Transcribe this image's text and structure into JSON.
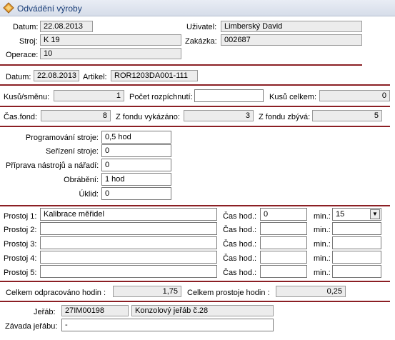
{
  "window": {
    "title": "Odvádění výroby",
    "icon": "diamond-arrows-icon"
  },
  "header": {
    "datum_label": "Datum:",
    "datum_value": "22.08.2013",
    "stroj_label": "Stroj:",
    "stroj_value": "K 19",
    "operace_label": "Operace:",
    "operace_value": "10",
    "uzivatel_label": "Uživatel:",
    "uzivatel_value": "Limberský David",
    "zakazka_label": "Zakázka:",
    "zakazka_value": "002687"
  },
  "second": {
    "datum_label": "Datum:",
    "datum_value": "22.08.2013",
    "artikel_label": "Artikel:",
    "artikel_value": "ROR1203DA001-111"
  },
  "counts": {
    "kusu_smenu_label": "Kusů/směnu:",
    "kusu_smenu_value": "1",
    "pocet_rozpichnuti_label": "Počet rozpíchnutí:",
    "pocet_rozpichnuti_value": "",
    "kusu_celkem_label": "Kusů celkem:",
    "kusu_celkem_value": "0"
  },
  "fond": {
    "cas_fond_label": "Čas.fond:",
    "cas_fond_value": "8",
    "z_fondu_vykazano_label": "Z fondu vykázáno:",
    "z_fondu_vykazano_value": "3",
    "z_fondu_zbyva_label": "Z fondu zbývá:",
    "z_fondu_zbyva_value": "5"
  },
  "activities": [
    {
      "label": "Programování stroje:",
      "value": "0,5 hod"
    },
    {
      "label": "Seřízení stroje:",
      "value": "0"
    },
    {
      "label": "Příprava nástrojů a nářadí:",
      "value": "0"
    },
    {
      "label": "Obrábění:",
      "value": "1 hod"
    },
    {
      "label": "Úklid:",
      "value": "0"
    }
  ],
  "prostoje": [
    {
      "label": "Prostoj 1:",
      "value": "Kalibrace měřidel",
      "cas_label": "Čas hod.:",
      "cas_value": "0",
      "min_label": "min.:",
      "min_value": "15"
    },
    {
      "label": "Prostoj 2:",
      "value": "",
      "cas_label": "Čas hod.:",
      "cas_value": "",
      "min_label": "min.:",
      "min_value": ""
    },
    {
      "label": "Prostoj 3:",
      "value": "",
      "cas_label": "Čas hod.:",
      "cas_value": "",
      "min_label": "min.:",
      "min_value": ""
    },
    {
      "label": "Prostoj 4:",
      "value": "",
      "cas_label": "Čas hod.:",
      "cas_value": "",
      "min_label": "min.:",
      "min_value": ""
    },
    {
      "label": "Prostoj 5:",
      "value": "",
      "cas_label": "Čas hod.:",
      "cas_value": "",
      "min_label": "min.:",
      "min_value": ""
    }
  ],
  "totals": {
    "celkem_odpracovano_label": "Celkem odpracováno hodin  :",
    "celkem_odpracovano_value": "1,75",
    "celkem_prostoje_label": "Celkem prostoje hodin  :",
    "celkem_prostoje_value": "0,25"
  },
  "jerab": {
    "jerab_label": "Jeřáb:",
    "jerab_code": "27IM00198",
    "jerab_name": "Konzolový jeřáb č.28",
    "zavada_label": "Závada jeřábu:",
    "zavada_value": "-"
  },
  "colors": {
    "separator": "#8b1f24",
    "title_text": "#1b3f7a",
    "readonly_bg": "#ececec"
  }
}
